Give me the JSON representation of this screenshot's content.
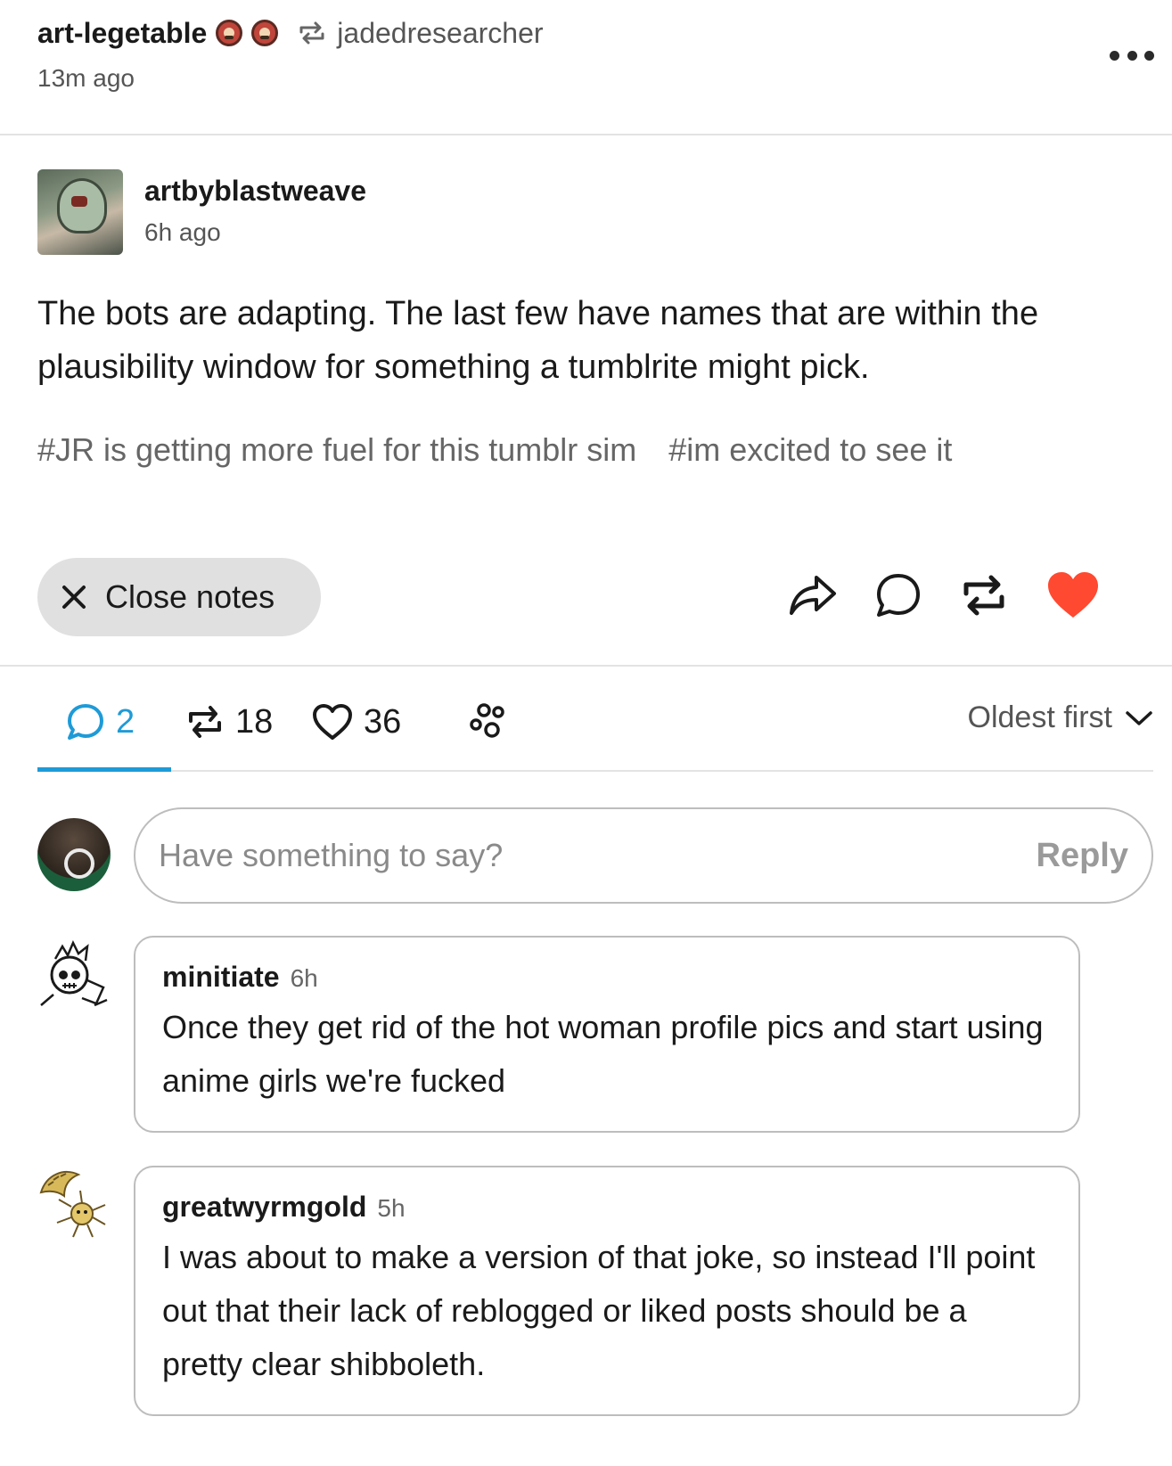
{
  "header": {
    "blog_name": "art-legetable",
    "reblogged_from": "jadedresearcher",
    "timestamp": "13m ago",
    "badge_icons": [
      "badge-icon",
      "badge-icon"
    ]
  },
  "post": {
    "author": "artbyblastweave",
    "timestamp": "6h ago",
    "body": "The bots are adapting. The last few have names that are within the plausibility window for something a tumblrite might pick.",
    "tags": [
      "#JR is getting more fuel for this tumblr sim",
      "#im excited to see it"
    ]
  },
  "actions": {
    "close_notes_label": "Close notes",
    "icons": [
      "share-icon",
      "reply-icon",
      "reblog-icon",
      "like-icon"
    ],
    "like_color": "#ff4930"
  },
  "notes": {
    "tabs": [
      {
        "icon": "comment-icon",
        "count": "2",
        "active": true
      },
      {
        "icon": "reblog-icon",
        "count": "18"
      },
      {
        "icon": "heart-icon",
        "count": "36"
      },
      {
        "icon": "community-icon",
        "count": ""
      }
    ],
    "sort_label": "Oldest first",
    "accent_color": "#1e9bd7"
  },
  "reply": {
    "placeholder": "Have something to say?",
    "button_label": "Reply"
  },
  "comments": [
    {
      "user": "minitiate",
      "time": "6h",
      "text": "Once they get rid of the hot woman profile pics and start using anime girls we're fucked"
    },
    {
      "user": "greatwyrmgold",
      "time": "5h",
      "text": "I was about to make a version of that joke, so instead I'll point out that their lack of reblogged or liked posts should be a pretty clear shibboleth."
    }
  ]
}
